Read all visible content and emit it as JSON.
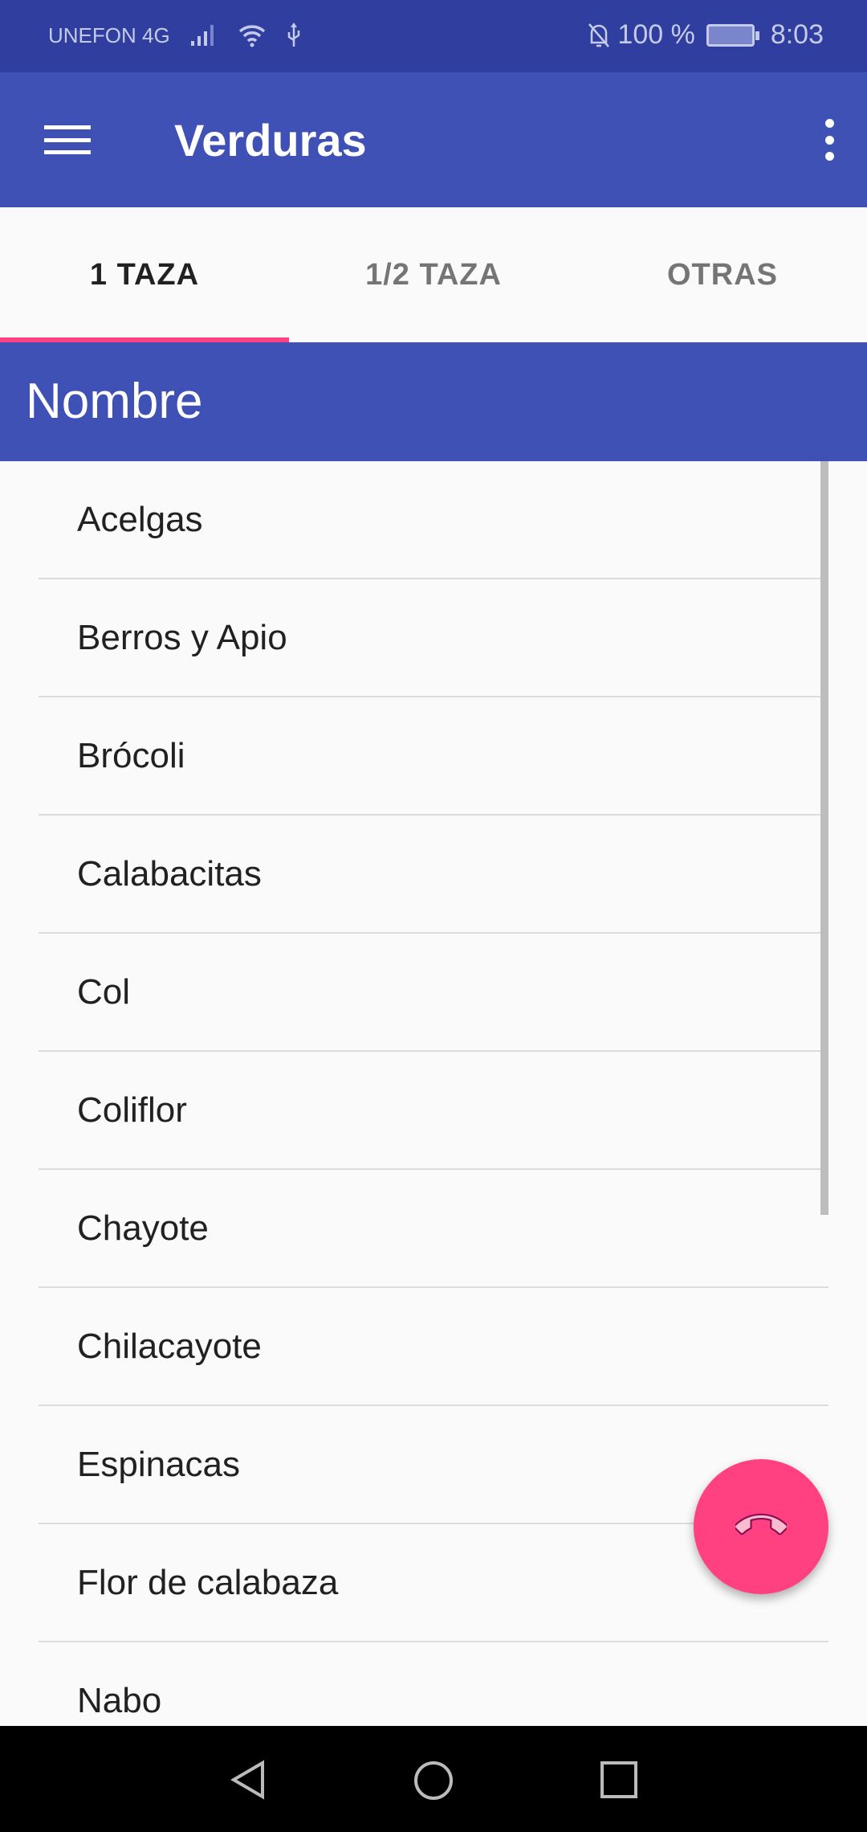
{
  "status_bar": {
    "carrier": "UNEFON 4G",
    "battery": "100 %",
    "time": "8:03",
    "battery_level": 1.0
  },
  "app_bar": {
    "title": "Verduras",
    "menu_icon": "hamburger-icon",
    "overflow_icon": "more-vert-icon"
  },
  "tabs": [
    {
      "label": "1 TAZA",
      "active": true
    },
    {
      "label": "1/2 TAZA",
      "active": false
    },
    {
      "label": "OTRAS",
      "active": false
    }
  ],
  "header": {
    "label": "Nombre"
  },
  "items": [
    "Acelgas",
    "Berros y Apio",
    "Brócoli",
    "Calabacitas",
    "Col",
    "Coliflor",
    "Chayote",
    "Chilacayote",
    "Espinacas",
    "Flor de calabaza",
    "Nabo"
  ],
  "fab": {
    "icon": "phone-icon"
  },
  "colors": {
    "primary": "#3F51B5",
    "primary_dark": "#303F9F",
    "accent": "#FF4081"
  }
}
